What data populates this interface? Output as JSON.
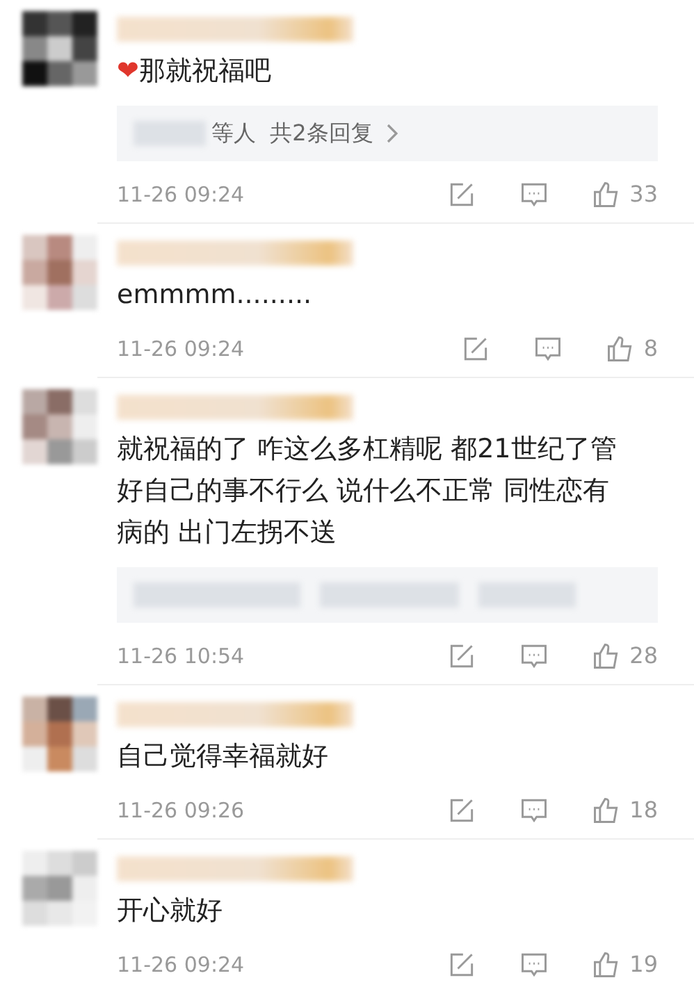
{
  "comments": [
    {
      "emoji": "❤",
      "text": "那就祝福吧",
      "replies": {
        "kind": "summary",
        "text": "等人  共2条回复"
      },
      "time": "11-26 09:24",
      "likes": "33"
    },
    {
      "text": "emmmm.........",
      "time": "11-26 09:24",
      "likes": "8"
    },
    {
      "text": "就祝福的了 咋这么多杠精呢 都21世纪了管好自己的事不行么 说什么不正常 同性恋有病的 出门左拐不送",
      "replies": {
        "kind": "hidden"
      },
      "time": "11-26 10:54",
      "likes": "28"
    },
    {
      "text": "自己觉得幸福就好",
      "time": "11-26 09:26",
      "likes": "18"
    },
    {
      "text": "开心就好",
      "time": "11-26 09:24",
      "likes": "19"
    }
  ]
}
